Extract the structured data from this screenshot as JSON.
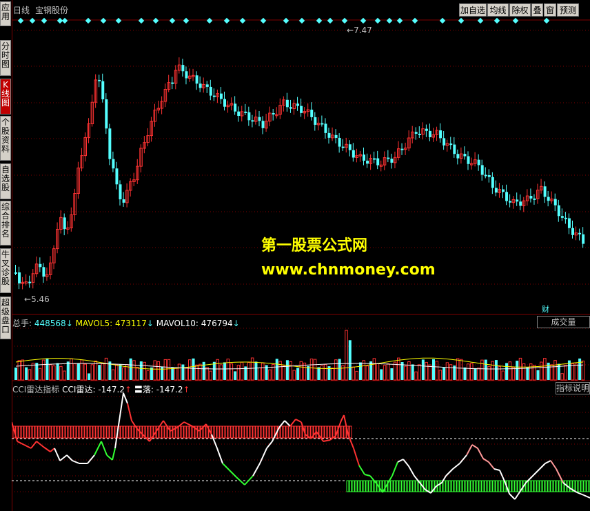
{
  "sidebar": {
    "items": [
      {
        "label": "应用",
        "active": false
      },
      {
        "label": "分时图",
        "active": false
      },
      {
        "label": "K线图",
        "active": true
      },
      {
        "label": "个股资料",
        "active": false
      },
      {
        "label": "自选股",
        "active": false
      },
      {
        "label": "综合排名",
        "active": false
      },
      {
        "label": "牛叉诊股",
        "active": false
      },
      {
        "label": "超级盘口",
        "active": false
      }
    ]
  },
  "header": {
    "period": "日线",
    "stock_name": "宝钢股份",
    "toolbar": [
      "加自选",
      "均线",
      "除权",
      "叠",
      "窗",
      "预测"
    ]
  },
  "price_chart": {
    "high_label": "7.47",
    "low_label": "5.46",
    "fin_marker": "财",
    "colors": {
      "up": "#ff3232",
      "down": "#54ffff",
      "background": "#000000",
      "grid": "#800000"
    }
  },
  "watermark": {
    "line1": "第一股票公式网",
    "line2": "www.chnmoney.com"
  },
  "volume_panel": {
    "label_total": "总手:",
    "total_value": "448568",
    "mavol5_label": "MAVOL5:",
    "mavol5_value": "473117",
    "mavol10_label": "MAVOL10:",
    "mavol10_value": "476794",
    "arrow_down": "↓",
    "button": "成交量"
  },
  "cci_panel": {
    "title": "CCI雷达指标",
    "cci_label": "CCI雷达:",
    "cci_value": "-147.2",
    "cci_arrow": "↑",
    "fall_label": "〓落:",
    "fall_value": "-147.2",
    "fall_arrow": "↑",
    "button": "指标说明"
  }
}
